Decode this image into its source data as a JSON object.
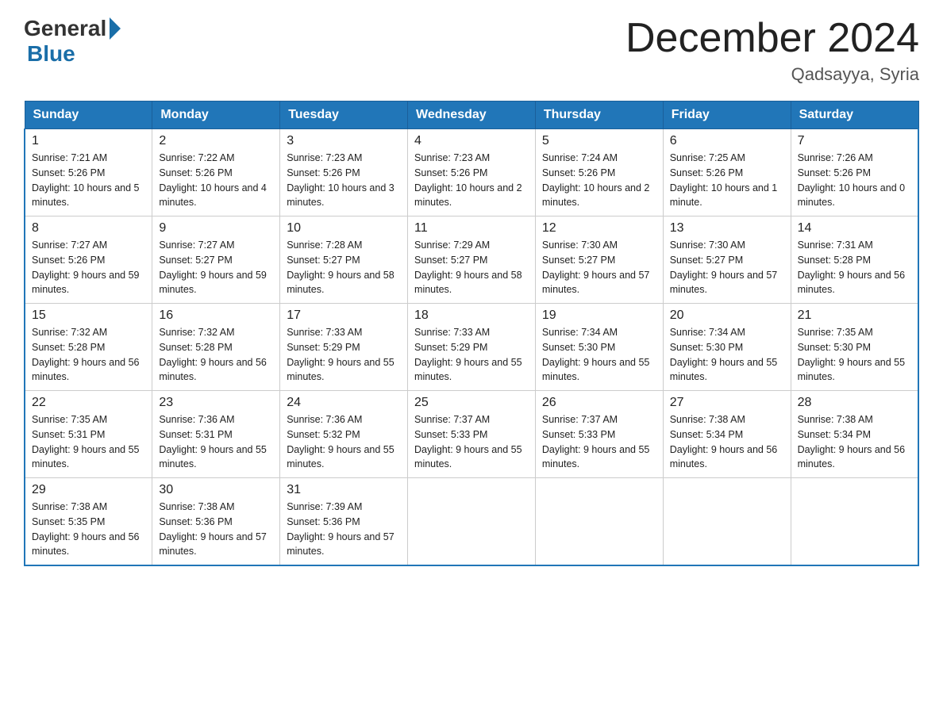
{
  "header": {
    "logo_general": "General",
    "logo_blue": "Blue",
    "month_title": "December 2024",
    "location": "Qadsayya, Syria"
  },
  "days_of_week": [
    "Sunday",
    "Monday",
    "Tuesday",
    "Wednesday",
    "Thursday",
    "Friday",
    "Saturday"
  ],
  "weeks": [
    [
      {
        "day": "1",
        "sunrise": "7:21 AM",
        "sunset": "5:26 PM",
        "daylight": "10 hours and 5 minutes."
      },
      {
        "day": "2",
        "sunrise": "7:22 AM",
        "sunset": "5:26 PM",
        "daylight": "10 hours and 4 minutes."
      },
      {
        "day": "3",
        "sunrise": "7:23 AM",
        "sunset": "5:26 PM",
        "daylight": "10 hours and 3 minutes."
      },
      {
        "day": "4",
        "sunrise": "7:23 AM",
        "sunset": "5:26 PM",
        "daylight": "10 hours and 2 minutes."
      },
      {
        "day": "5",
        "sunrise": "7:24 AM",
        "sunset": "5:26 PM",
        "daylight": "10 hours and 2 minutes."
      },
      {
        "day": "6",
        "sunrise": "7:25 AM",
        "sunset": "5:26 PM",
        "daylight": "10 hours and 1 minute."
      },
      {
        "day": "7",
        "sunrise": "7:26 AM",
        "sunset": "5:26 PM",
        "daylight": "10 hours and 0 minutes."
      }
    ],
    [
      {
        "day": "8",
        "sunrise": "7:27 AM",
        "sunset": "5:26 PM",
        "daylight": "9 hours and 59 minutes."
      },
      {
        "day": "9",
        "sunrise": "7:27 AM",
        "sunset": "5:27 PM",
        "daylight": "9 hours and 59 minutes."
      },
      {
        "day": "10",
        "sunrise": "7:28 AM",
        "sunset": "5:27 PM",
        "daylight": "9 hours and 58 minutes."
      },
      {
        "day": "11",
        "sunrise": "7:29 AM",
        "sunset": "5:27 PM",
        "daylight": "9 hours and 58 minutes."
      },
      {
        "day": "12",
        "sunrise": "7:30 AM",
        "sunset": "5:27 PM",
        "daylight": "9 hours and 57 minutes."
      },
      {
        "day": "13",
        "sunrise": "7:30 AM",
        "sunset": "5:27 PM",
        "daylight": "9 hours and 57 minutes."
      },
      {
        "day": "14",
        "sunrise": "7:31 AM",
        "sunset": "5:28 PM",
        "daylight": "9 hours and 56 minutes."
      }
    ],
    [
      {
        "day": "15",
        "sunrise": "7:32 AM",
        "sunset": "5:28 PM",
        "daylight": "9 hours and 56 minutes."
      },
      {
        "day": "16",
        "sunrise": "7:32 AM",
        "sunset": "5:28 PM",
        "daylight": "9 hours and 56 minutes."
      },
      {
        "day": "17",
        "sunrise": "7:33 AM",
        "sunset": "5:29 PM",
        "daylight": "9 hours and 55 minutes."
      },
      {
        "day": "18",
        "sunrise": "7:33 AM",
        "sunset": "5:29 PM",
        "daylight": "9 hours and 55 minutes."
      },
      {
        "day": "19",
        "sunrise": "7:34 AM",
        "sunset": "5:30 PM",
        "daylight": "9 hours and 55 minutes."
      },
      {
        "day": "20",
        "sunrise": "7:34 AM",
        "sunset": "5:30 PM",
        "daylight": "9 hours and 55 minutes."
      },
      {
        "day": "21",
        "sunrise": "7:35 AM",
        "sunset": "5:30 PM",
        "daylight": "9 hours and 55 minutes."
      }
    ],
    [
      {
        "day": "22",
        "sunrise": "7:35 AM",
        "sunset": "5:31 PM",
        "daylight": "9 hours and 55 minutes."
      },
      {
        "day": "23",
        "sunrise": "7:36 AM",
        "sunset": "5:31 PM",
        "daylight": "9 hours and 55 minutes."
      },
      {
        "day": "24",
        "sunrise": "7:36 AM",
        "sunset": "5:32 PM",
        "daylight": "9 hours and 55 minutes."
      },
      {
        "day": "25",
        "sunrise": "7:37 AM",
        "sunset": "5:33 PM",
        "daylight": "9 hours and 55 minutes."
      },
      {
        "day": "26",
        "sunrise": "7:37 AM",
        "sunset": "5:33 PM",
        "daylight": "9 hours and 55 minutes."
      },
      {
        "day": "27",
        "sunrise": "7:38 AM",
        "sunset": "5:34 PM",
        "daylight": "9 hours and 56 minutes."
      },
      {
        "day": "28",
        "sunrise": "7:38 AM",
        "sunset": "5:34 PM",
        "daylight": "9 hours and 56 minutes."
      }
    ],
    [
      {
        "day": "29",
        "sunrise": "7:38 AM",
        "sunset": "5:35 PM",
        "daylight": "9 hours and 56 minutes."
      },
      {
        "day": "30",
        "sunrise": "7:38 AM",
        "sunset": "5:36 PM",
        "daylight": "9 hours and 57 minutes."
      },
      {
        "day": "31",
        "sunrise": "7:39 AM",
        "sunset": "5:36 PM",
        "daylight": "9 hours and 57 minutes."
      },
      null,
      null,
      null,
      null
    ]
  ]
}
